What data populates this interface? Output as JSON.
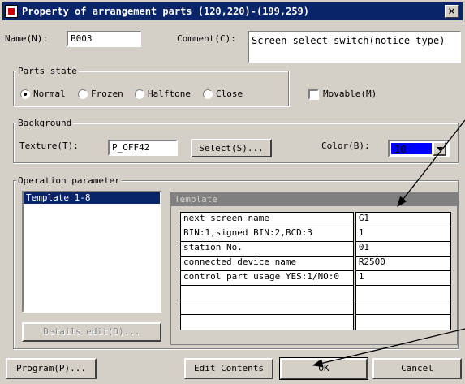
{
  "window": {
    "title": "Property of arrangement parts (120,220)-(199,259)"
  },
  "name": {
    "label": "Name(N):",
    "value": "B003"
  },
  "comment": {
    "label": "Comment(C):",
    "value": "Screen select switch(notice type)"
  },
  "parts_state": {
    "title": "Parts state",
    "options": [
      {
        "label": "Normal",
        "selected": true
      },
      {
        "label": "Frozen",
        "selected": false
      },
      {
        "label": "Halftone",
        "selected": false
      },
      {
        "label": "Close",
        "selected": false
      }
    ],
    "movable_label": "Movable(M)",
    "movable_checked": false
  },
  "background": {
    "title": "Background",
    "texture_label": "Texture(T):",
    "texture_value": "P_OFF42",
    "select_button": "Select(S)...",
    "color_label": "Color(B):",
    "color_value": "10",
    "color_swatch": "#0000ff"
  },
  "operation": {
    "title": "Operation parameter",
    "list_items": [
      "Template 1-8"
    ],
    "details_button": "Details edit(D)...",
    "template_header": "Template",
    "rows": [
      {
        "name": "next screen name",
        "value": "G1"
      },
      {
        "name": "BIN:1,signed BIN:2,BCD:3",
        "value": "1"
      },
      {
        "name": "station No.",
        "value": "01"
      },
      {
        "name": "connected device name",
        "value": "R2500"
      },
      {
        "name": "control part usage YES:1/NO:0",
        "value": "1"
      },
      {
        "name": "",
        "value": ""
      },
      {
        "name": "",
        "value": ""
      },
      {
        "name": "",
        "value": ""
      }
    ]
  },
  "footer": {
    "program_button": "Program(P)...",
    "edit_button": "Edit Contents",
    "ok_button": "OK",
    "cancel_button": "Cancel"
  }
}
